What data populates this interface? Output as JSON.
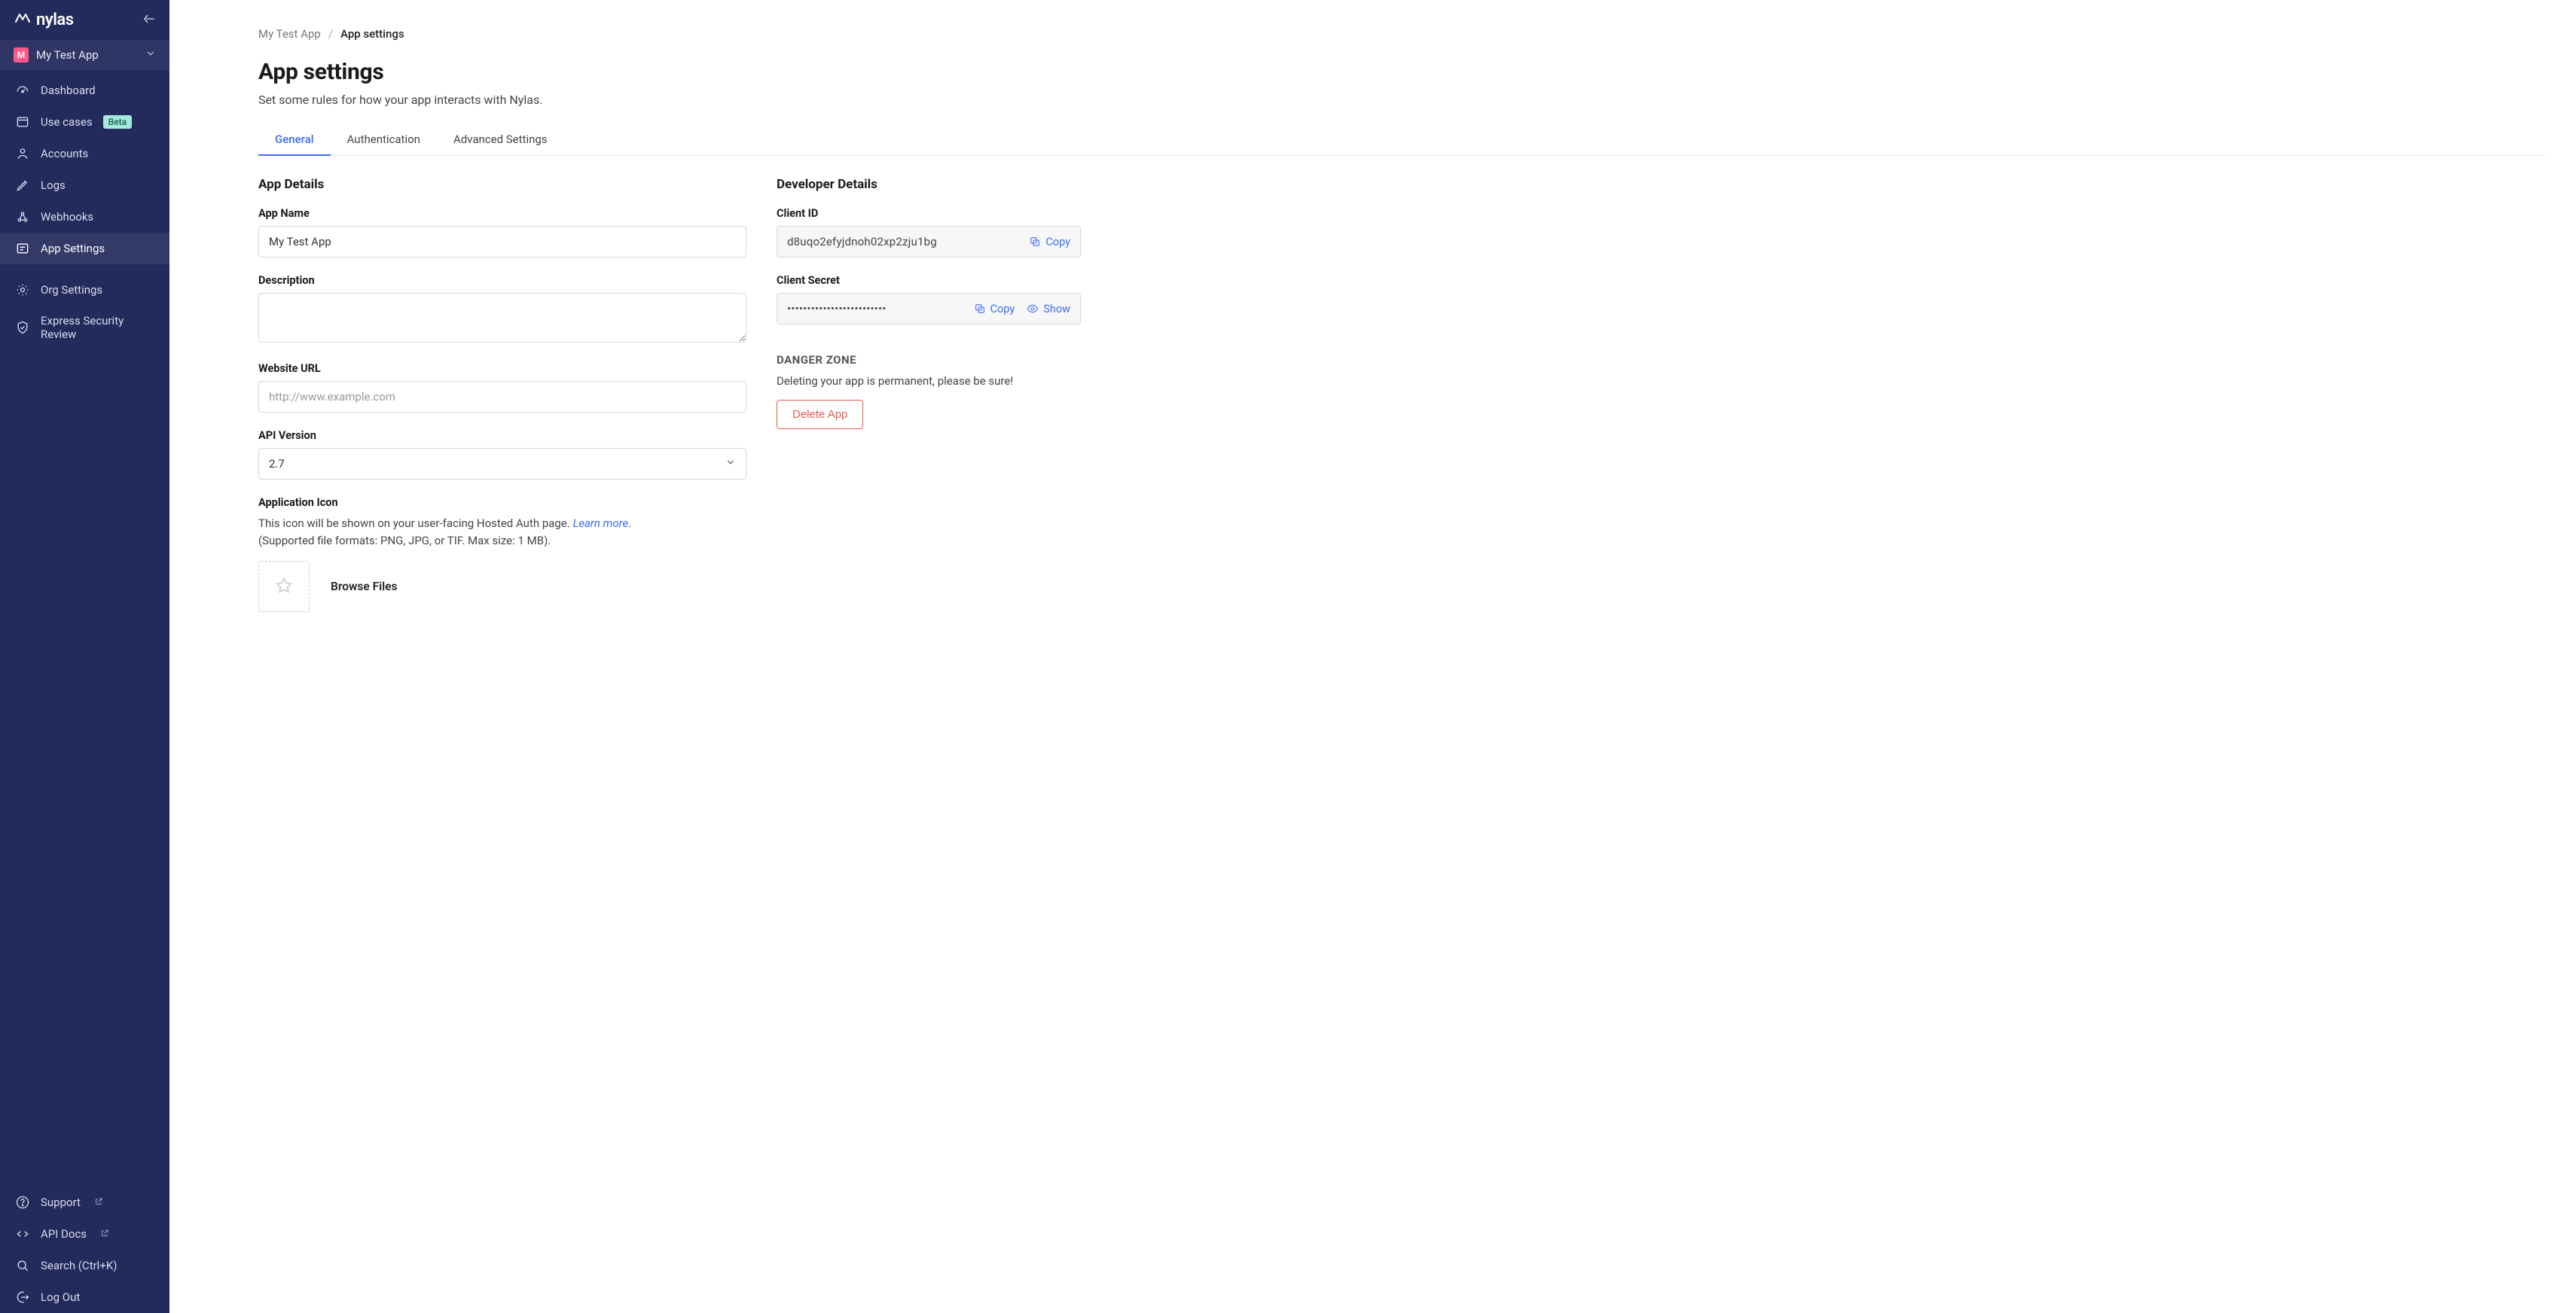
{
  "brand": {
    "name": "nylas"
  },
  "sidebar": {
    "app": {
      "initial": "M",
      "name": "My Test App"
    },
    "primary": [
      {
        "label": "Dashboard"
      },
      {
        "label": "Use cases",
        "badge": "Beta"
      },
      {
        "label": "Accounts"
      },
      {
        "label": "Logs"
      },
      {
        "label": "Webhooks"
      },
      {
        "label": "App Settings"
      }
    ],
    "secondary": [
      {
        "label": "Org Settings"
      },
      {
        "label": "Express Security Review"
      }
    ],
    "footer": [
      {
        "label": "Support"
      },
      {
        "label": "API Docs"
      },
      {
        "label": "Search (Ctrl+K)"
      },
      {
        "label": "Log Out"
      }
    ]
  },
  "breadcrumbs": {
    "parent": "My Test App",
    "current": "App settings"
  },
  "page": {
    "title": "App settings",
    "subtitle": "Set some rules for how your app interacts with Nylas."
  },
  "tabs": [
    {
      "label": "General"
    },
    {
      "label": "Authentication"
    },
    {
      "label": "Advanced Settings"
    }
  ],
  "app_details": {
    "heading": "App Details",
    "name_label": "App Name",
    "name_value": "My Test App",
    "description_label": "Description",
    "description_value": "",
    "website_label": "Website URL",
    "website_placeholder": "http://www.example.com",
    "website_value": "",
    "api_version_label": "API Version",
    "api_version_value": "2.7",
    "icon_label": "Application Icon",
    "icon_helper_prefix": "This icon will be shown on your user-facing Hosted Auth page. ",
    "icon_learn_more": "Learn more",
    "icon_helper_suffix": ".",
    "icon_formats": "(Supported file formats: PNG, JPG, or TIF. Max size: 1 MB).",
    "browse_label": "Browse Files"
  },
  "dev_details": {
    "heading": "Developer Details",
    "client_id_label": "Client ID",
    "client_id_value": "d8uqo2efyjdnoh02xp2zju1bg",
    "client_secret_label": "Client Secret",
    "client_secret_masked": "•••••••••••••••••••••••••",
    "copy_label": "Copy",
    "show_label": "Show"
  },
  "danger": {
    "heading": "DANGER ZONE",
    "text": "Deleting your app is permanent, please be sure!",
    "button": "Delete App"
  }
}
